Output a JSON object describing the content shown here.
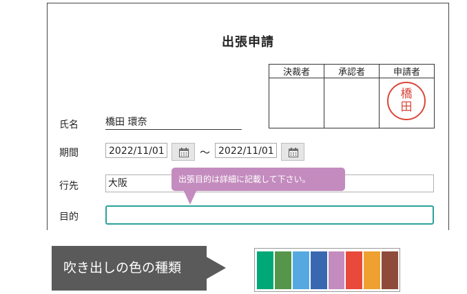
{
  "form": {
    "title": "出張申請",
    "approval_headers": [
      "決裁者",
      "承認者",
      "申請者"
    ],
    "stamp_text": [
      "橋",
      "田"
    ],
    "fields": {
      "name_label": "氏名",
      "name_value": "橋田 環奈",
      "period_label": "期間",
      "date_from": "2022/11/01",
      "date_separator": "～",
      "date_to": "2022/11/01",
      "destination_label": "行先",
      "destination_value": "大阪",
      "purpose_label": "目的",
      "purpose_value": ""
    }
  },
  "tooltip": {
    "text": "出張目的は詳細に記載して下さい。"
  },
  "banner": {
    "text": "吹き出しの色の種類"
  },
  "swatch_colors": [
    "#00a878",
    "#56964a",
    "#55a9e0",
    "#3a68b0",
    "#c48cbe",
    "#e8493a",
    "#eea030",
    "#8e4a3a"
  ],
  "icons": {
    "calendar": "calendar-icon"
  },
  "colors": {
    "stamp": "#d9463a",
    "focus_border": "#2aa198",
    "tooltip_bg": "#c48cbe",
    "banner_bg": "#5a5a5a"
  }
}
